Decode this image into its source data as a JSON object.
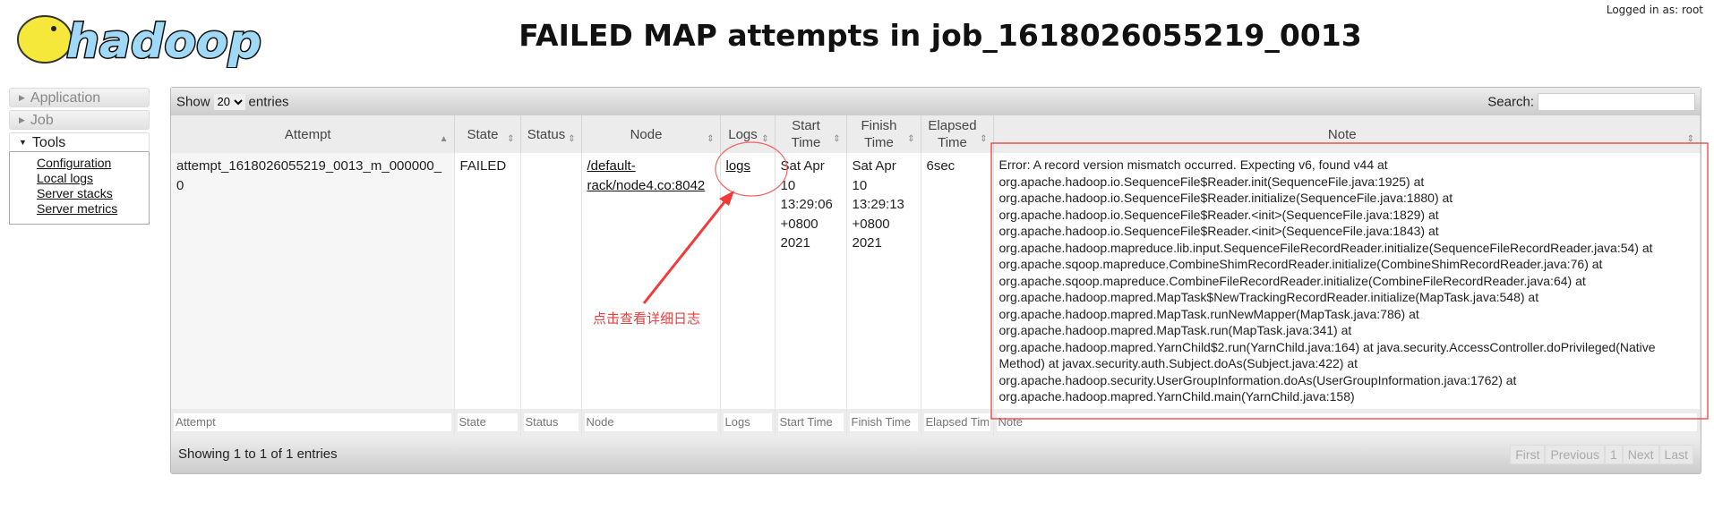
{
  "header": {
    "logo_text": "hadoop",
    "title": "FAILED MAP attempts in job_1618026055219_0013",
    "logged_in": "Logged in as: root"
  },
  "sidebar": {
    "application": "Application",
    "job": "Job",
    "tools": "Tools",
    "tool_links": [
      "Configuration",
      "Local logs",
      "Server stacks",
      "Server metrics"
    ]
  },
  "table": {
    "show_label": "Show",
    "entries_label": "entries",
    "page_size": "20",
    "search_label": "Search:",
    "search_value": "",
    "columns": [
      "Attempt",
      "State",
      "Status",
      "Node",
      "Logs",
      "Start Time",
      "Finish Time",
      "Elapsed Time",
      "Note"
    ],
    "rows": [
      {
        "attempt": "attempt_1618026055219_0013_m_000000_0",
        "state": "FAILED",
        "status": "",
        "node": "/default-rack/node4.co:8042",
        "logs": "logs",
        "start": "Sat Apr 10 13:29:06 +0800 2021",
        "finish": "Sat Apr 10 13:29:13 +0800 2021",
        "elapsed": "6sec",
        "note": "Error: A record version mismatch occurred. Expecting v6, found v44 at org.apache.hadoop.io.SequenceFile$Reader.init(SequenceFile.java:1925) at org.apache.hadoop.io.SequenceFile$Reader.initialize(SequenceFile.java:1880) at org.apache.hadoop.io.SequenceFile$Reader.<init>(SequenceFile.java:1829) at org.apache.hadoop.io.SequenceFile$Reader.<init>(SequenceFile.java:1843) at org.apache.hadoop.mapreduce.lib.input.SequenceFileRecordReader.initialize(SequenceFileRecordReader.java:54) at org.apache.sqoop.mapreduce.CombineShimRecordReader.initialize(CombineShimRecordReader.java:76) at org.apache.sqoop.mapreduce.CombineFileRecordReader.initialize(CombineFileRecordReader.java:64) at org.apache.hadoop.mapred.MapTask$NewTrackingRecordReader.initialize(MapTask.java:548) at org.apache.hadoop.mapred.MapTask.runNewMapper(MapTask.java:786) at org.apache.hadoop.mapred.MapTask.run(MapTask.java:341) at org.apache.hadoop.mapred.YarnChild$2.run(YarnChild.java:164) at java.security.AccessController.doPrivileged(Native Method) at javax.security.auth.Subject.doAs(Subject.java:422) at org.apache.hadoop.security.UserGroupInformation.doAs(UserGroupInformation.java:1762) at org.apache.hadoop.mapred.YarnChild.main(YarnChild.java:158)"
      }
    ],
    "filters": [
      "Attempt",
      "State",
      "Status",
      "Node",
      "Logs",
      "Start Time",
      "Finish Time",
      "Elapsed Time",
      "Note"
    ],
    "info": "Showing 1 to 1 of 1 entries",
    "pagination": [
      "First",
      "Previous",
      "1",
      "Next",
      "Last"
    ]
  },
  "annotation": {
    "text": "点击查看详细日志",
    "color": "#f23a3a"
  }
}
